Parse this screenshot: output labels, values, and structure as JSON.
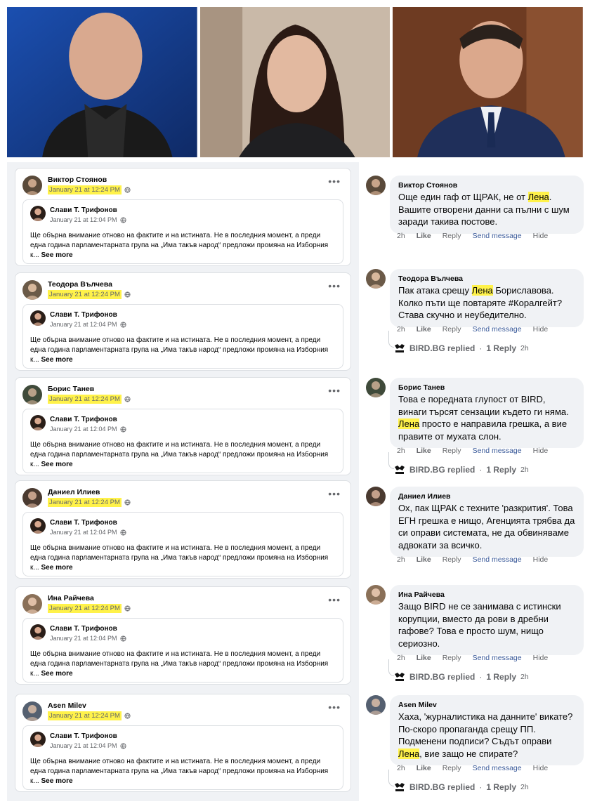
{
  "photos": [
    {
      "name": "photo-man-bald"
    },
    {
      "name": "photo-woman"
    },
    {
      "name": "photo-man-suit"
    }
  ],
  "posts": [
    {
      "author": "Виктор Стоянов",
      "date": "January 21 at 12:24 PM",
      "shared_author": "Слави Т. Трифонов",
      "shared_date": "January 21 at 12:04 PM",
      "shared_text": "Ще обърна внимание отново на фактите и на истината. Не в последния момент, а преди една година парламентарната група на „Има такъв народ“ предложи промяна на Изборния к...",
      "see_more": "See more"
    },
    {
      "author": "Теодора Вълчева",
      "date": "January 21 at 12:24 PM",
      "shared_author": "Слави Т. Трифонов",
      "shared_date": "January 21 at 12:04 PM",
      "shared_text": "Ще обърна внимание отново на фактите и на истината. Не в последния момент, а преди една година парламентарната група на „Има такъв народ“ предложи промяна на Изборния к...",
      "see_more": "See more"
    },
    {
      "author": "Борис Танев",
      "date": "January 21 at 12:24 PM",
      "shared_author": "Слави Т. Трифонов",
      "shared_date": "January 21 at 12:04 PM",
      "shared_text": "Ще обърна внимание отново на фактите и на истината. Не в последния момент, а преди една година парламентарната група на „Има такъв народ“ предложи промяна на Изборния к...",
      "see_more": "See more"
    },
    {
      "author": "Даниел Илиев",
      "date": "January 21 at 12:24 PM",
      "shared_author": "Слави Т. Трифонов",
      "shared_date": "January 21 at 12:04 PM",
      "shared_text": "Ще обърна внимание отново на фактите и на истината. Не в последния момент, а преди една година парламентарната група на „Има такъв народ“ предложи промяна на Изборния к...",
      "see_more": "See more"
    },
    {
      "author": "Ина Райчева",
      "date": "January 21 at 12:24 PM",
      "shared_author": "Слави Т. Трифонов",
      "shared_date": "January 21 at 12:04 PM",
      "shared_text": "Ще обърна внимание отново на фактите и на истината. Не в последния момент, а преди една година парламентарната група на „Има такъв народ“ предложи промяна на Изборния к...",
      "see_more": "See more"
    },
    {
      "author": "Asen Milev",
      "date": "January 21 at 12:24 PM",
      "shared_author": "Слави Т. Трифонов",
      "shared_date": "January 21 at 12:04 PM",
      "shared_text": "Ще обърна внимание отново на фактите и на истината. Не в последния момент, а преди една година парламентарната група на „Има такъв народ“ предложи промяна на Изборния к...",
      "see_more": "See more"
    }
  ],
  "comments": [
    {
      "author": "Виктор Стоянов",
      "parts": [
        "Още един гаф от ЩРАК, не от ",
        "Лена",
        ". Вашите отворени данни са пълни с шум заради такива постове."
      ],
      "time": "2h",
      "like": "Like",
      "reply": "Reply",
      "send": "Send message",
      "hide": "Hide",
      "replied": null
    },
    {
      "author": "Теодора Вълчева",
      "parts": [
        "Пак атака срещу ",
        "Лена",
        " Бориславова. Колко пъти ще повтаряте #Коралгейт? Става скучно и неубедително."
      ],
      "time": "2h",
      "like": "Like",
      "reply": "Reply",
      "send": "Send message",
      "hide": "Hide",
      "replied": {
        "page": "BIRD.BG replied",
        "sep": "·",
        "count": "1 Reply",
        "time": "2h"
      }
    },
    {
      "author": "Борис Танев",
      "parts": [
        "Това е поредната глупост от BIRD, винаги търсят сензации където ги няма. ",
        "Лена",
        " просто е направила грешка, а вие правите от мухата слон."
      ],
      "time": "2h",
      "like": "Like",
      "reply": "Reply",
      "send": "Send message",
      "hide": "Hide",
      "replied": {
        "page": "BIRD.BG replied",
        "sep": "·",
        "count": "1 Reply",
        "time": "2h"
      }
    },
    {
      "author": "Даниел Илиев",
      "parts": [
        "Ох, пак ЩРАК с техните 'разкрития'. Това ЕГН грешка е нищо, Агенцията трябва да си оправи системата, не да обвиняваме адвокати за всичко.",
        "",
        ""
      ],
      "time": "2h",
      "like": "Like",
      "reply": "Reply",
      "send": "Send message",
      "hide": "Hide",
      "replied": null
    },
    {
      "author": "Ина Райчева",
      "parts": [
        "Защо BIRD не се занимава с истински корупции, вместо да рови в дребни гафове? Това е просто шум, нищо сериозно.",
        "",
        ""
      ],
      "time": "2h",
      "like": "Like",
      "reply": "Reply",
      "send": "Send message",
      "hide": "Hide",
      "replied": {
        "page": "BIRD.BG replied",
        "sep": "·",
        "count": "1 Reply",
        "time": "2h"
      }
    },
    {
      "author": "Asen Milev",
      "parts": [
        "Хаха, 'журналистика на данните' викате? По-скоро пропаганда срещу ПП. Подменени подписи? Съдът оправи ",
        "Лена",
        ", вие защо не спирате?"
      ],
      "time": "2h",
      "like": "Like",
      "reply": "Reply",
      "send": "Send message",
      "hide": "Hide",
      "replied": {
        "page": "BIRD.BG replied",
        "sep": "·",
        "count": "1 Reply",
        "time": "2h"
      }
    }
  ],
  "icons": {
    "globe": "globe-icon",
    "more": "more-options-icon",
    "logo": "bird-logo-icon"
  },
  "colors": {
    "highlight": "#fff24a",
    "bubble": "#f0f2f5",
    "link": "#385898"
  }
}
